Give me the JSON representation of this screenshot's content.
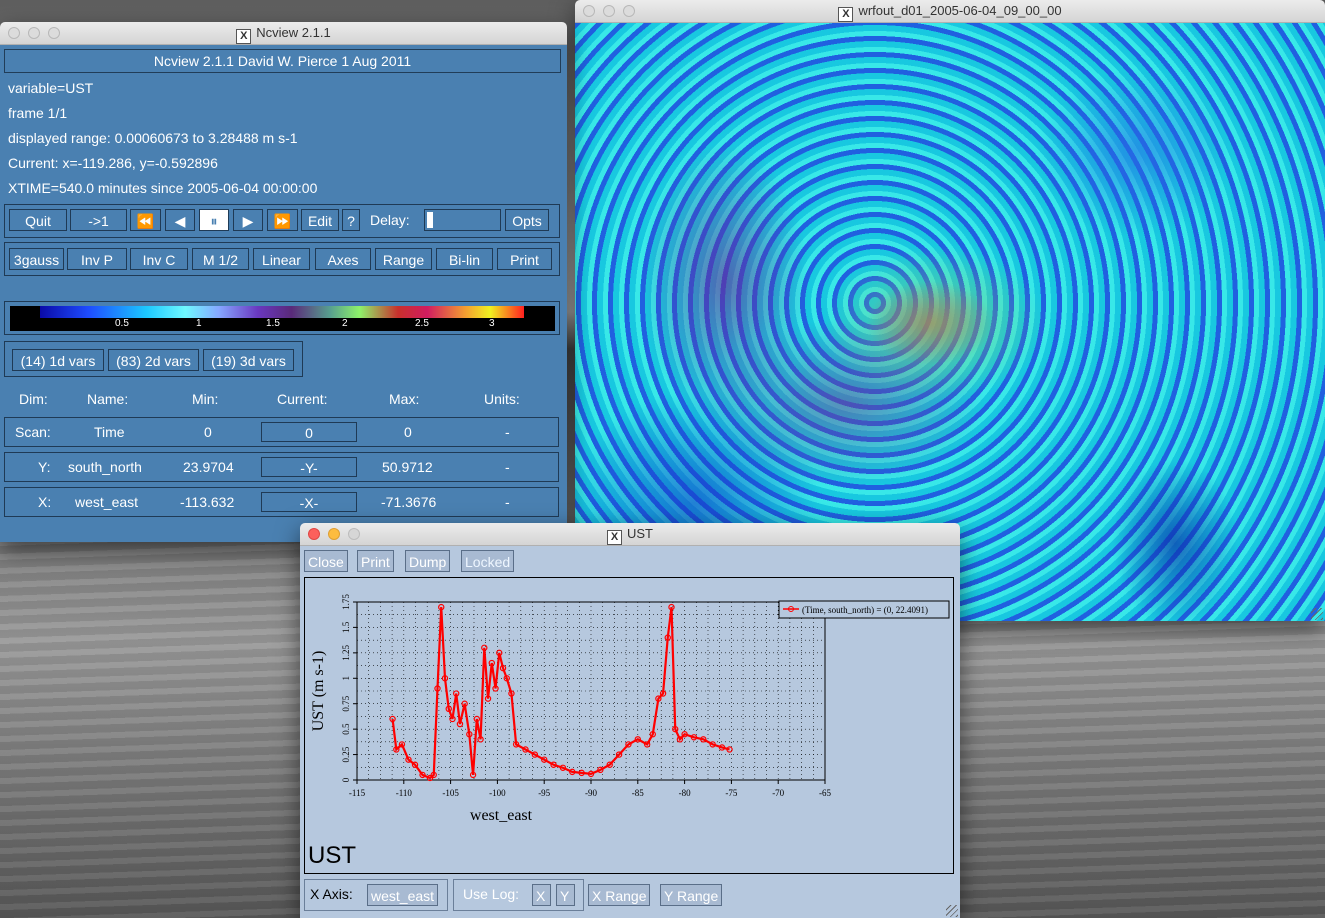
{
  "main_window": {
    "title": "Ncview 2.1.1",
    "header": "Ncview 2.1.1 David W. Pierce  1 Aug 2011",
    "variable": "variable=UST",
    "frame": "frame 1/1",
    "range": "displayed range: 0.00060673 to 3.28488 m s-1",
    "current": "Current: x=-119.286, y=-0.592896",
    "xtime": "XTIME=540.0 minutes since 2005-06-04 00:00:00",
    "controls": {
      "quit": "Quit",
      "to1": "->1",
      "rewind": "⏪",
      "back": "◀",
      "pause": "⏸",
      "forward": "▶",
      "fastforward": "⏩",
      "edit": "Edit",
      "help": "?",
      "delay": "Delay:",
      "opts": "Opts"
    },
    "tools": [
      "3gauss",
      "Inv P",
      "Inv C",
      "M 1/2",
      "Linear",
      "Axes",
      "Range",
      "Bi-lin",
      "Print"
    ],
    "colorbar_ticks": [
      "0.5",
      "1",
      "1.5",
      "2",
      "2.5",
      "3"
    ],
    "var_groups": [
      "(14) 1d vars",
      "(83) 2d vars",
      "(19) 3d vars"
    ],
    "columns": [
      "Dim:",
      "Name:",
      "Min:",
      "Current:",
      "Max:",
      "Units:"
    ],
    "dims": [
      {
        "dim": "Scan:",
        "name": "Time",
        "min": "0",
        "current": "0",
        "max": "0",
        "units": "-"
      },
      {
        "dim": "Y:",
        "name": "south_north",
        "min": "23.9704",
        "current": "-Y-",
        "max": "50.9712",
        "units": "-"
      },
      {
        "dim": "X:",
        "name": "west_east",
        "min": "-113.632",
        "current": "-X-",
        "max": "-71.3676",
        "units": "-"
      }
    ]
  },
  "map_window": {
    "title": "wrfout_d01_2005-06-04_09_00_00"
  },
  "plot_window": {
    "title": "UST",
    "buttons": [
      "Close",
      "Print",
      "Dump",
      "Locked"
    ],
    "var_name": "UST",
    "xaxis_label": "X Axis:",
    "xaxis_value": "west_east",
    "uselog_label": "Use Log:",
    "log_x": "X",
    "log_y": "Y",
    "xrange": "X Range",
    "yrange": "Y Range"
  },
  "chart_data": {
    "type": "line",
    "xlabel": "west_east",
    "ylabel": "UST (m s-1)",
    "xlim": [
      -115,
      -65
    ],
    "ylim": [
      0,
      1.75
    ],
    "x_ticks": [
      "-115",
      "-110",
      "-105",
      "-100",
      "-95",
      "-90",
      "-85",
      "-80",
      "-75",
      "-70",
      "-65"
    ],
    "y_ticks": [
      "0",
      "0.25",
      "0.5",
      "0.75",
      "1",
      "1.25",
      "1.5",
      "1.75"
    ],
    "series": [
      {
        "name": "(Time, south_north) = (0, 22.4091)",
        "color": "#ff0000",
        "x": [
          -111.2,
          -110.8,
          -110.2,
          -109.5,
          -108.8,
          -108,
          -107.2,
          -106.8,
          -106.4,
          -106,
          -105.6,
          -105.2,
          -104.8,
          -104.4,
          -104,
          -103.5,
          -103,
          -102.6,
          -102.2,
          -101.8,
          -101.4,
          -101,
          -100.6,
          -100.2,
          -99.8,
          -99.4,
          -99,
          -98.5,
          -98,
          -97,
          -96,
          -95,
          -94,
          -93,
          -92,
          -91,
          -90,
          -89,
          -88,
          -87,
          -86,
          -85,
          -84,
          -83.4,
          -82.8,
          -82.3,
          -81.8,
          -81.4,
          -81,
          -80.5,
          -80,
          -79,
          -78,
          -77,
          -76,
          -75.2
        ],
        "y": [
          0.6,
          0.3,
          0.35,
          0.2,
          0.15,
          0.05,
          0.02,
          0.05,
          0.9,
          1.7,
          1.0,
          0.7,
          0.6,
          0.85,
          0.55,
          0.75,
          0.45,
          0.05,
          0.6,
          0.4,
          1.3,
          0.8,
          1.15,
          0.9,
          1.25,
          1.1,
          1.0,
          0.85,
          0.35,
          0.3,
          0.25,
          0.2,
          0.15,
          0.12,
          0.08,
          0.07,
          0.06,
          0.1,
          0.15,
          0.25,
          0.35,
          0.4,
          0.35,
          0.45,
          0.8,
          0.85,
          1.4,
          1.7,
          0.5,
          0.4,
          0.45,
          0.42,
          0.4,
          0.35,
          0.32,
          0.3
        ]
      }
    ],
    "legend": "top-right",
    "grid": true
  }
}
